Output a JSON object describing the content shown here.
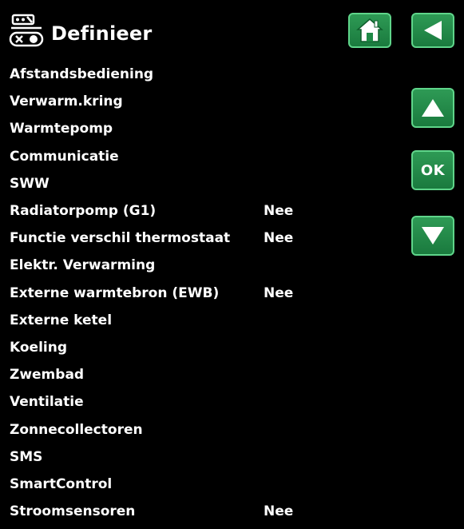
{
  "header": {
    "title": "Definieer",
    "icon": "remote-control-icon"
  },
  "nav": {
    "home_icon": "home-icon",
    "back_icon": "back-arrow-icon",
    "up_icon": "arrow-up-icon",
    "ok_label": "OK",
    "down_icon": "arrow-down-icon",
    "button_color": "#1f8a47",
    "button_border": "#5fd58a"
  },
  "menu": {
    "items": [
      {
        "label": "Afstandsbediening",
        "value": ""
      },
      {
        "label": "Verwarm.kring",
        "value": ""
      },
      {
        "label": "Warmtepomp",
        "value": ""
      },
      {
        "label": "Communicatie",
        "value": ""
      },
      {
        "label": "SWW",
        "value": ""
      },
      {
        "label": "Radiatorpomp (G1)",
        "value": "Nee"
      },
      {
        "label": "Functie verschil thermostaat",
        "value": "Nee"
      },
      {
        "label": "Elektr. Verwarming",
        "value": ""
      },
      {
        "label": "Externe warmtebron (EWB)",
        "value": "Nee"
      },
      {
        "label": "Externe ketel",
        "value": ""
      },
      {
        "label": "Koeling",
        "value": ""
      },
      {
        "label": "Zwembad",
        "value": ""
      },
      {
        "label": "Ventilatie",
        "value": ""
      },
      {
        "label": "Zonnecollectoren",
        "value": ""
      },
      {
        "label": "SMS",
        "value": ""
      },
      {
        "label": "SmartControl",
        "value": ""
      },
      {
        "label": "Stroomsensoren",
        "value": "Nee"
      }
    ]
  }
}
